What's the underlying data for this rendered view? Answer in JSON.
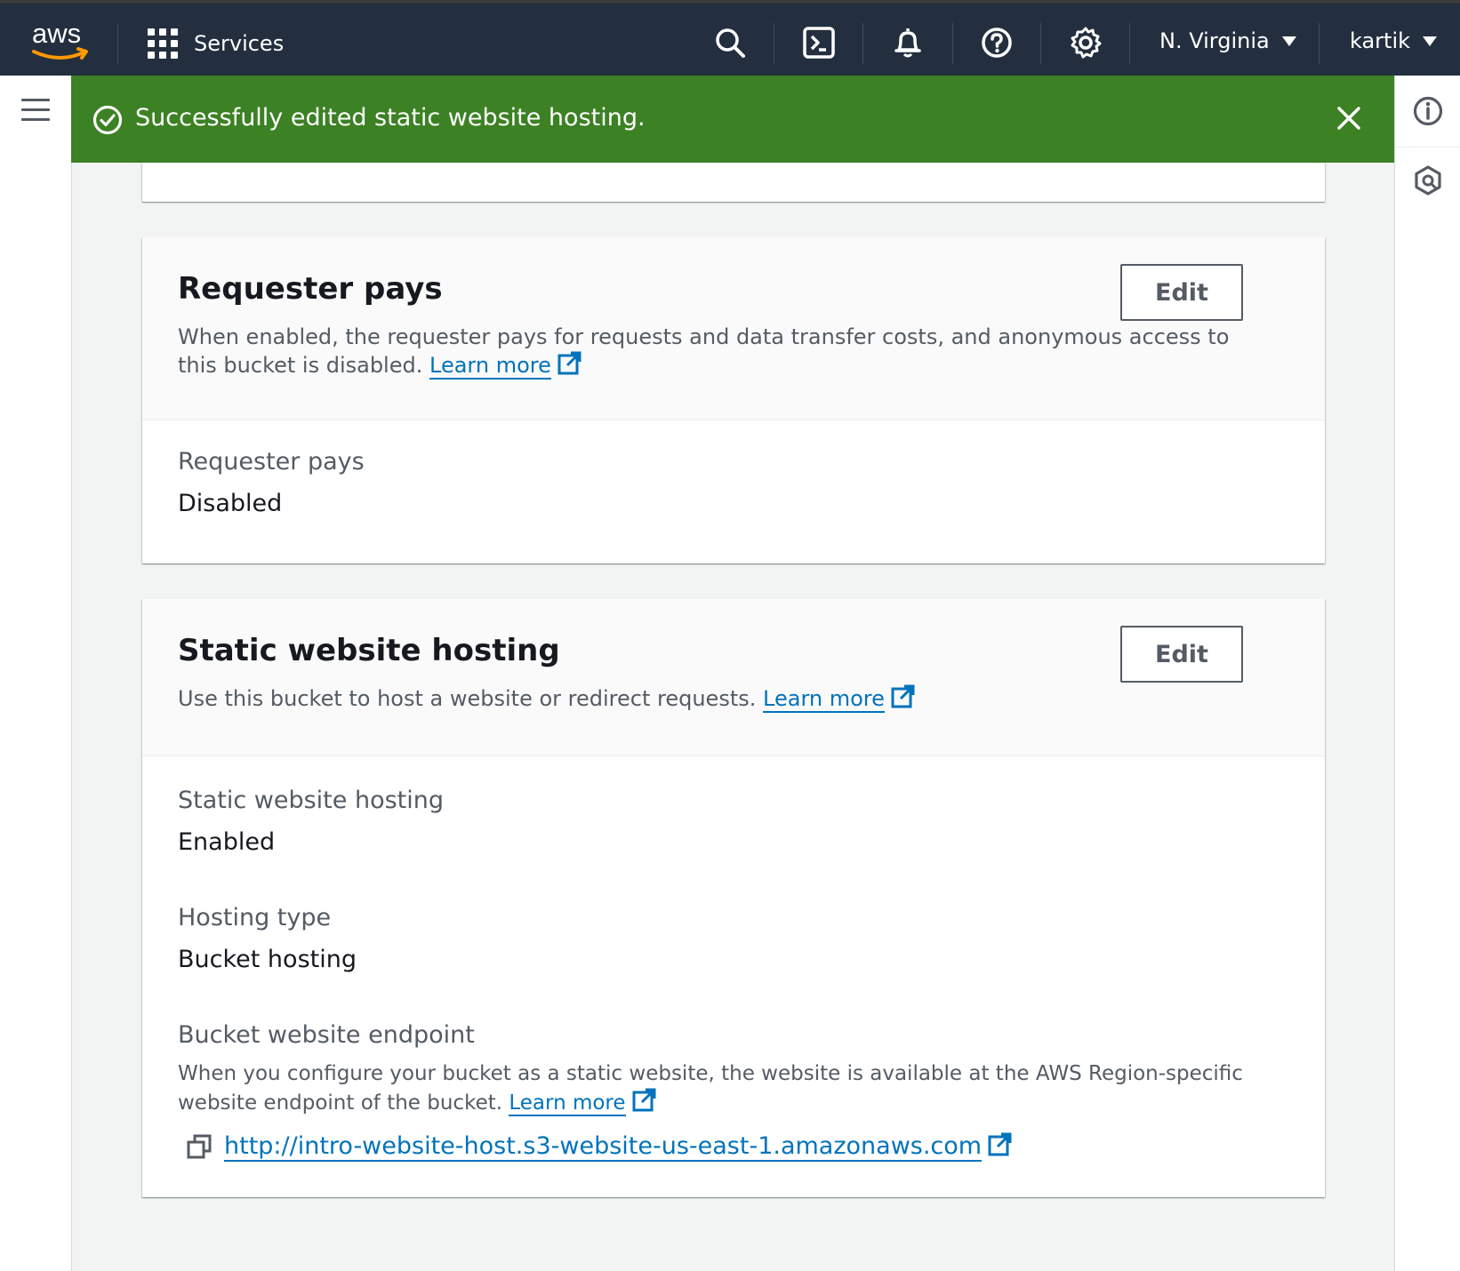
{
  "topnav": {
    "logo_text": "aws",
    "services_label": "Services",
    "region_label": "N. Virginia",
    "user_label": "kartik",
    "icons": [
      "search-icon",
      "cloudshell-icon",
      "bell-icon",
      "help-icon",
      "settings-icon"
    ]
  },
  "flash": {
    "message": "Successfully edited static website hosting.",
    "status_color": "#3c8124"
  },
  "requester_pays": {
    "title": "Requester pays",
    "edit_label": "Edit",
    "description": "When enabled, the requester pays for requests and data transfer costs, and anonymous access to this bucket is disabled.",
    "learn_more": "Learn more",
    "field_label": "Requester pays",
    "field_value": "Disabled"
  },
  "static_hosting": {
    "title": "Static website hosting",
    "edit_label": "Edit",
    "description": "Use this bucket to host a website or redirect requests.",
    "learn_more": "Learn more",
    "status_label": "Static website hosting",
    "status_value": "Enabled",
    "type_label": "Hosting type",
    "type_value": "Bucket hosting",
    "endpoint_label": "Bucket website endpoint",
    "endpoint_description": "When you configure your bucket as a static website, the website is available at the AWS Region-specific website endpoint of the bucket.",
    "endpoint_learn_more": "Learn more",
    "endpoint_url": "http://intro-website-host.s3-website-us-east-1.amazonaws.com"
  },
  "colors": {
    "nav_bg": "#232f3e",
    "link": "#0073bb",
    "aws_orange": "#ff9900"
  }
}
